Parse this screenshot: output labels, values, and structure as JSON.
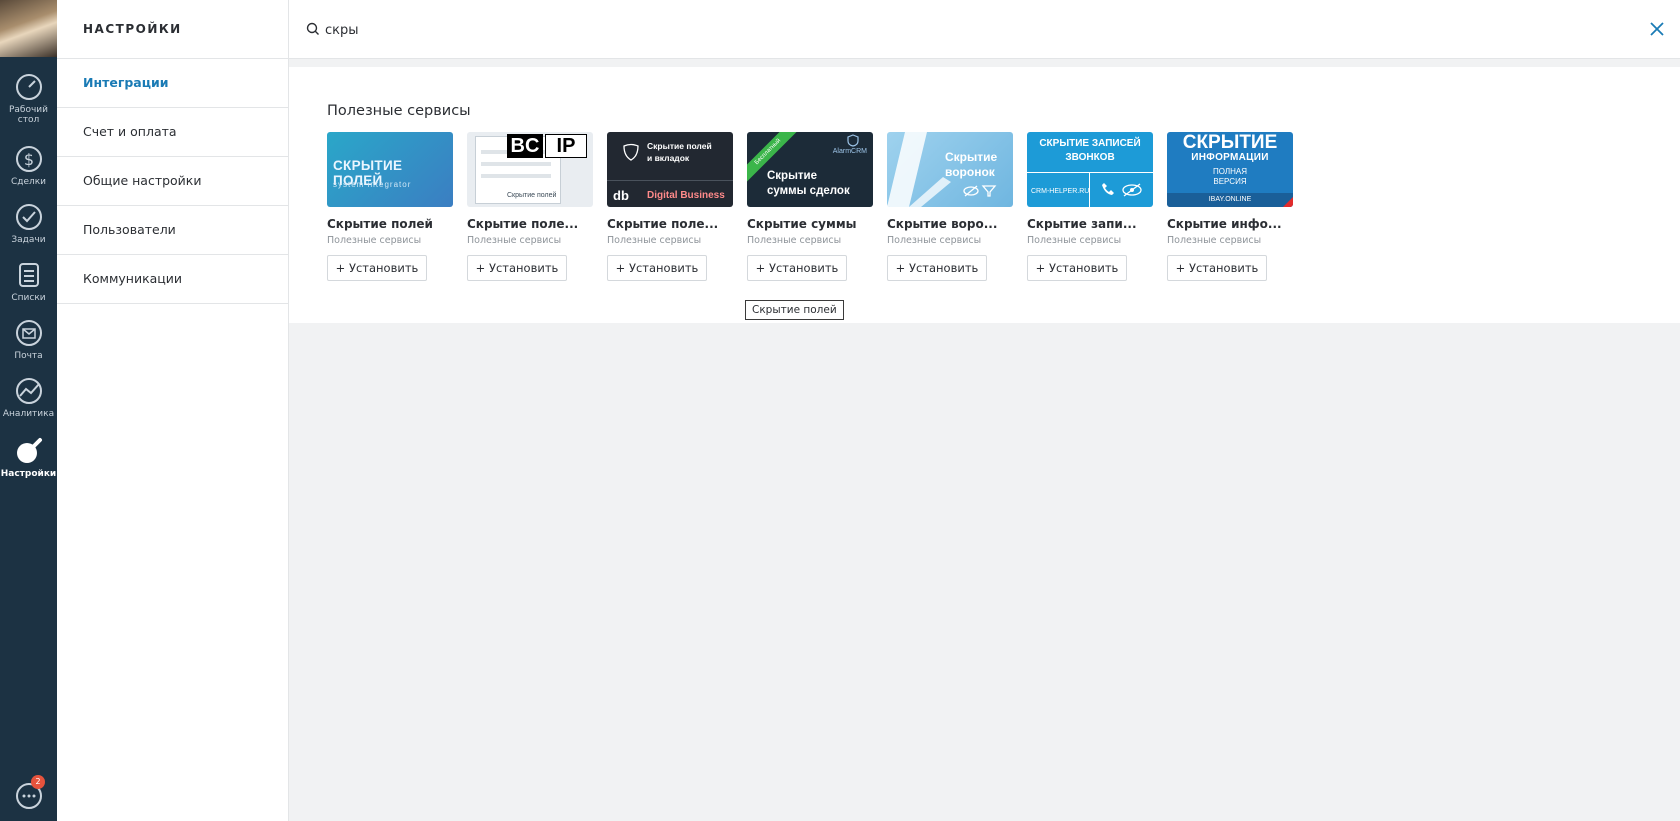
{
  "nav": {
    "items": [
      {
        "label": "Рабочий стол",
        "icon": "dashboard-icon"
      },
      {
        "label": "Сделки",
        "icon": "dollar-icon"
      },
      {
        "label": "Задачи",
        "icon": "check-icon"
      },
      {
        "label": "Списки",
        "icon": "list-icon"
      },
      {
        "label": "Почта",
        "icon": "mail-icon"
      },
      {
        "label": "Аналитика",
        "icon": "analytics-icon"
      },
      {
        "label": "Настройки",
        "icon": "settings-icon"
      }
    ],
    "chat_badge": "2"
  },
  "menu": {
    "title": "НАСТРОЙКИ",
    "items": [
      {
        "label": "Интеграции",
        "active": true
      },
      {
        "label": "Счет и оплата"
      },
      {
        "label": "Общие настройки"
      },
      {
        "label": "Пользователи"
      },
      {
        "label": "Коммуникации"
      }
    ]
  },
  "search": {
    "value": "скры"
  },
  "results": {
    "section_title": "Полезные сервисы",
    "install_label": "+ Установить",
    "cards": [
      {
        "name": "Скрытие полей",
        "category": "Полезные сервисы",
        "thumb_text": [
          "СКРЫТИЕ ПОЛЕЙ",
          "system integrator"
        ]
      },
      {
        "name": "Скрытие поле...",
        "category": "Полезные сервисы",
        "thumb_text": [
          "BC",
          "IP",
          "Скрытие полей"
        ]
      },
      {
        "name": "Скрытие поле...",
        "category": "Полезные сервисы",
        "thumb_text": [
          "Скрытие полей",
          "и вкладок",
          "Digital Business"
        ]
      },
      {
        "name": "Скрытие суммы",
        "category": "Полезные сервисы",
        "thumb_text": [
          "Бесплатный",
          "AlarmCRM",
          "Скрытие",
          "суммы сделок"
        ]
      },
      {
        "name": "Скрытие воро...",
        "category": "Полезные сервисы",
        "thumb_text": [
          "Скрытие",
          "воронок"
        ]
      },
      {
        "name": "Скрытие запи...",
        "category": "Полезные сервисы",
        "thumb_text": [
          "СКРЫТИЕ ЗАПИСЕЙ",
          "ЗВОНКОВ",
          "CRM-HELPER.RU"
        ]
      },
      {
        "name": "Скрытие инфо...",
        "category": "Полезные сервисы",
        "thumb_text": [
          "СКРЫТИЕ",
          "ИНФОРМАЦИИ",
          "ПОЛНАЯ",
          "ВЕРСИЯ",
          "IBAY.ONLINE"
        ]
      }
    ],
    "tooltip": "Скрытие полей"
  }
}
